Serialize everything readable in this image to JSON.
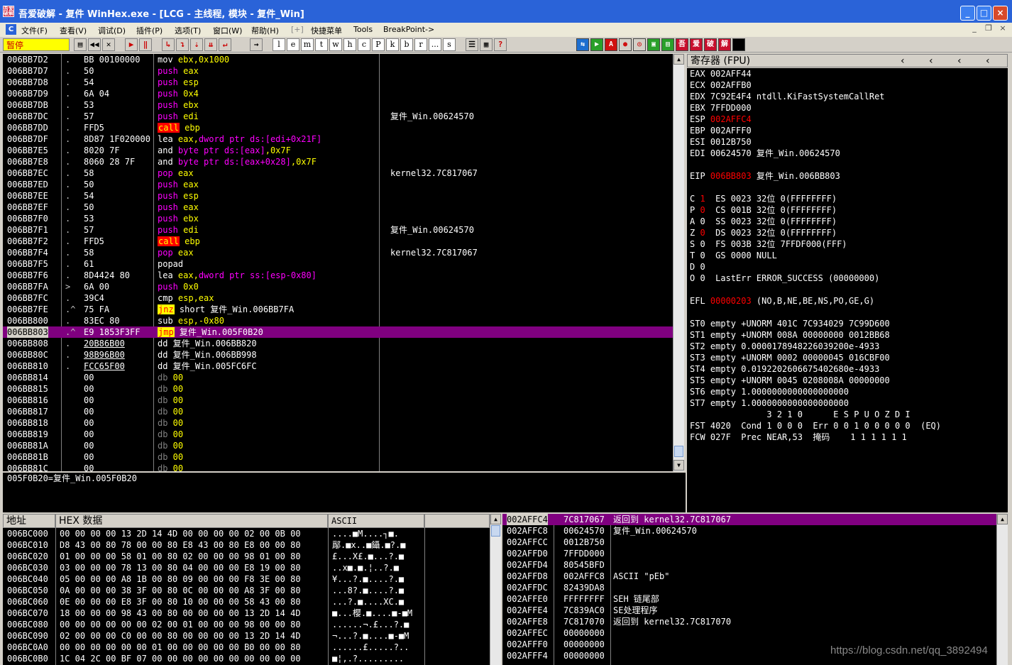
{
  "window": {
    "title": "吾爱破解 - 复件 WinHex.exe - [LCG - 主线程, 模块 - 复件_Win]",
    "logo": "吾爱破解"
  },
  "menu": [
    "文件(F)",
    "查看(V)",
    "调试(D)",
    "插件(P)",
    "选项(T)",
    "窗口(W)",
    "帮助(H)",
    "[+]",
    "快捷菜单",
    "Tools",
    "BreakPoint->"
  ],
  "toolbar": {
    "status": "暂停",
    "letters": [
      "l",
      "e",
      "m",
      "t",
      "w",
      "h",
      "c",
      "P",
      "k",
      "b",
      "r",
      "...",
      "s"
    ],
    "brand": [
      "吾",
      "爱",
      "破",
      "解"
    ]
  },
  "disasm": [
    {
      "addr": "006BB7D2",
      "mark": ".",
      "hex": "BB 00100000",
      "asm": [
        [
          "mov",
          "kw-mov"
        ],
        [
          " ebx,",
          "op-reg"
        ],
        [
          "0x1000",
          "op-num"
        ]
      ],
      "cmt": ""
    },
    {
      "addr": "006BB7D7",
      "mark": ".",
      "hex": "50",
      "asm": [
        [
          "push",
          "kw-push"
        ],
        [
          " eax",
          "op-reg"
        ]
      ],
      "cmt": ""
    },
    {
      "addr": "006BB7D8",
      "mark": ".",
      "hex": "54",
      "asm": [
        [
          "push",
          "kw-push"
        ],
        [
          " esp",
          "op-reg"
        ]
      ],
      "cmt": ""
    },
    {
      "addr": "006BB7D9",
      "mark": ".",
      "hex": "6A 04",
      "asm": [
        [
          "push",
          "kw-push"
        ],
        [
          " 0x4",
          "op-num"
        ]
      ],
      "cmt": ""
    },
    {
      "addr": "006BB7DB",
      "mark": ".",
      "hex": "53",
      "asm": [
        [
          "push",
          "kw-push"
        ],
        [
          " ebx",
          "op-reg"
        ]
      ],
      "cmt": ""
    },
    {
      "addr": "006BB7DC",
      "mark": ".",
      "hex": "57",
      "asm": [
        [
          "push",
          "kw-push"
        ],
        [
          " edi",
          "op-reg"
        ]
      ],
      "cmt": "复件_Win.00624570"
    },
    {
      "addr": "006BB7DD",
      "mark": ".",
      "hex": "FFD5",
      "asm": [
        [
          "call",
          "kw-call"
        ],
        [
          " ebp",
          "op-reg"
        ]
      ],
      "cmt": ""
    },
    {
      "addr": "006BB7DF",
      "mark": ".",
      "hex": "8D87 1F020000",
      "asm": [
        [
          "lea",
          "kw-lea"
        ],
        [
          " eax,",
          "op-reg"
        ],
        [
          "dword ptr ds:[edi+0x21F]",
          "op-mem"
        ]
      ],
      "cmt": ""
    },
    {
      "addr": "006BB7E5",
      "mark": ".",
      "hex": "8020 7F",
      "asm": [
        [
          "and",
          "kw-and"
        ],
        [
          " byte ptr ds:[eax]",
          "op-mem"
        ],
        [
          ",0x7F",
          "op-num"
        ]
      ],
      "cmt": ""
    },
    {
      "addr": "006BB7E8",
      "mark": ".",
      "hex": "8060 28 7F",
      "asm": [
        [
          "and",
          "kw-and"
        ],
        [
          " byte ptr ds:[eax+0x28]",
          "op-mem"
        ],
        [
          ",0x7F",
          "op-num"
        ]
      ],
      "cmt": ""
    },
    {
      "addr": "006BB7EC",
      "mark": ".",
      "hex": "58",
      "asm": [
        [
          "pop",
          "kw-pop"
        ],
        [
          " eax",
          "op-reg"
        ]
      ],
      "cmt": "kernel32.7C817067"
    },
    {
      "addr": "006BB7ED",
      "mark": ".",
      "hex": "50",
      "asm": [
        [
          "push",
          "kw-push"
        ],
        [
          " eax",
          "op-reg"
        ]
      ],
      "cmt": ""
    },
    {
      "addr": "006BB7EE",
      "mark": ".",
      "hex": "54",
      "asm": [
        [
          "push",
          "kw-push"
        ],
        [
          " esp",
          "op-reg"
        ]
      ],
      "cmt": ""
    },
    {
      "addr": "006BB7EF",
      "mark": ".",
      "hex": "50",
      "asm": [
        [
          "push",
          "kw-push"
        ],
        [
          " eax",
          "op-reg"
        ]
      ],
      "cmt": ""
    },
    {
      "addr": "006BB7F0",
      "mark": ".",
      "hex": "53",
      "asm": [
        [
          "push",
          "kw-push"
        ],
        [
          " ebx",
          "op-reg"
        ]
      ],
      "cmt": ""
    },
    {
      "addr": "006BB7F1",
      "mark": ".",
      "hex": "57",
      "asm": [
        [
          "push",
          "kw-push"
        ],
        [
          " edi",
          "op-reg"
        ]
      ],
      "cmt": "复件_Win.00624570"
    },
    {
      "addr": "006BB7F2",
      "mark": ".",
      "hex": "FFD5",
      "asm": [
        [
          "call",
          "kw-call"
        ],
        [
          " ebp",
          "op-reg"
        ]
      ],
      "cmt": ""
    },
    {
      "addr": "006BB7F4",
      "mark": ".",
      "hex": "58",
      "asm": [
        [
          "pop",
          "kw-pop"
        ],
        [
          " eax",
          "op-reg"
        ]
      ],
      "cmt": "kernel32.7C817067"
    },
    {
      "addr": "006BB7F5",
      "mark": ".",
      "hex": "61",
      "asm": [
        [
          "popad",
          "kw-popad"
        ]
      ],
      "cmt": ""
    },
    {
      "addr": "006BB7F6",
      "mark": ".",
      "hex": "8D4424 80",
      "asm": [
        [
          "lea",
          "kw-lea"
        ],
        [
          " eax,",
          "op-reg"
        ],
        [
          "dword ptr ss:[esp-0x80]",
          "op-mem"
        ]
      ],
      "cmt": ""
    },
    {
      "addr": "006BB7FA",
      "mark": ">",
      "hex": "6A 00",
      "asm": [
        [
          "push",
          "kw-push"
        ],
        [
          " 0x0",
          "op-num"
        ]
      ],
      "cmt": ""
    },
    {
      "addr": "006BB7FC",
      "mark": ".",
      "hex": "39C4",
      "asm": [
        [
          "cmp",
          "kw-cmp"
        ],
        [
          " esp,eax",
          "op-reg"
        ]
      ],
      "cmt": ""
    },
    {
      "addr": "006BB7FE",
      "mark": ".^",
      "hex": "75 FA",
      "asm": [
        [
          "jnz",
          "kw-jcc"
        ],
        [
          " short 复件_Win.006BB7FA",
          "op-plain"
        ]
      ],
      "cmt": ""
    },
    {
      "addr": "006BB800",
      "mark": ".",
      "hex": "83EC 80",
      "asm": [
        [
          "sub",
          "kw-sub"
        ],
        [
          " esp,",
          "op-reg"
        ],
        [
          "-0x80",
          "op-num"
        ]
      ],
      "cmt": ""
    },
    {
      "addr": "006BB803",
      "mark": ".^",
      "hex": "E9 1853F3FF",
      "asm": [
        [
          "jmp",
          "kw-jcc"
        ],
        [
          " 复件_Win.005F0B20",
          "op-plain"
        ]
      ],
      "cmt": "",
      "sel": true
    },
    {
      "addr": "006BB808",
      "mark": ".",
      "hex": "20B86B00",
      "asm": [
        [
          "dd",
          "kw-dd"
        ],
        [
          " 复件_Win.006BB820",
          "op-plain"
        ]
      ],
      "cmt": "",
      "ul": true
    },
    {
      "addr": "006BB80C",
      "mark": ".",
      "hex": "98B96B00",
      "asm": [
        [
          "dd",
          "kw-dd"
        ],
        [
          " 复件_Win.006BB998",
          "op-plain"
        ]
      ],
      "cmt": "",
      "ul": true
    },
    {
      "addr": "006BB810",
      "mark": ".",
      "hex": "FCC65F00",
      "asm": [
        [
          "dd",
          "kw-dd"
        ],
        [
          " 复件_Win.005FC6FC",
          "op-plain"
        ]
      ],
      "cmt": "",
      "ul": true
    },
    {
      "addr": "006BB814",
      "mark": "",
      "hex": "00",
      "asm": [
        [
          "db",
          "kw-db"
        ],
        [
          " 00",
          "op-reg"
        ]
      ],
      "cmt": ""
    },
    {
      "addr": "006BB815",
      "mark": "",
      "hex": "00",
      "asm": [
        [
          "db",
          "kw-db"
        ],
        [
          " 00",
          "op-reg"
        ]
      ],
      "cmt": ""
    },
    {
      "addr": "006BB816",
      "mark": "",
      "hex": "00",
      "asm": [
        [
          "db",
          "kw-db"
        ],
        [
          " 00",
          "op-reg"
        ]
      ],
      "cmt": ""
    },
    {
      "addr": "006BB817",
      "mark": "",
      "hex": "00",
      "asm": [
        [
          "db",
          "kw-db"
        ],
        [
          " 00",
          "op-reg"
        ]
      ],
      "cmt": ""
    },
    {
      "addr": "006BB818",
      "mark": "",
      "hex": "00",
      "asm": [
        [
          "db",
          "kw-db"
        ],
        [
          " 00",
          "op-reg"
        ]
      ],
      "cmt": ""
    },
    {
      "addr": "006BB819",
      "mark": "",
      "hex": "00",
      "asm": [
        [
          "db",
          "kw-db"
        ],
        [
          " 00",
          "op-reg"
        ]
      ],
      "cmt": ""
    },
    {
      "addr": "006BB81A",
      "mark": "",
      "hex": "00",
      "asm": [
        [
          "db",
          "kw-db"
        ],
        [
          " 00",
          "op-reg"
        ]
      ],
      "cmt": ""
    },
    {
      "addr": "006BB81B",
      "mark": "",
      "hex": "00",
      "asm": [
        [
          "db",
          "kw-db"
        ],
        [
          " 00",
          "op-reg"
        ]
      ],
      "cmt": ""
    },
    {
      "addr": "006BB81C",
      "mark": "",
      "hex": "00",
      "asm": [
        [
          "db",
          "kw-db"
        ],
        [
          " 00",
          "op-reg"
        ]
      ],
      "cmt": ""
    }
  ],
  "info_line": "005F0B20=复件_Win.005F0B20",
  "registers": {
    "title": "寄存器 (FPU)",
    "lines": [
      [
        [
          "EAX 002AFF44",
          ""
        ]
      ],
      [
        [
          "ECX 002AFFB0",
          ""
        ]
      ],
      [
        [
          "EDX 7C92E4F4 ntdll.KiFastSystemCallRet",
          ""
        ]
      ],
      [
        [
          "EBX 7FFDD000",
          ""
        ]
      ],
      [
        [
          "ESP ",
          ""
        ],
        [
          "002AFFC4",
          "red"
        ]
      ],
      [
        [
          "EBP 002AFFF0",
          ""
        ]
      ],
      [
        [
          "ESI 0012B750",
          ""
        ]
      ],
      [
        [
          "EDI 00624570 复件_Win.00624570",
          ""
        ]
      ],
      [
        [
          "",
          ""
        ]
      ],
      [
        [
          "EIP ",
          ""
        ],
        [
          "006BB803",
          "red"
        ],
        [
          " 复件_Win.006BB803",
          ""
        ]
      ],
      [
        [
          "",
          ""
        ]
      ],
      [
        [
          "C ",
          ""
        ],
        [
          "1",
          "red"
        ],
        [
          "  ES 0023 32位 0(FFFFFFFF)",
          ""
        ]
      ],
      [
        [
          "P ",
          ""
        ],
        [
          "0",
          "red"
        ],
        [
          "  CS 001B 32位 0(FFFFFFFF)",
          ""
        ]
      ],
      [
        [
          "A 0  SS 0023 32位 0(FFFFFFFF)",
          ""
        ]
      ],
      [
        [
          "Z ",
          ""
        ],
        [
          "0",
          "red"
        ],
        [
          "  DS 0023 32位 0(FFFFFFFF)",
          ""
        ]
      ],
      [
        [
          "S 0  FS 003B 32位 7FFDF000(FFF)",
          ""
        ]
      ],
      [
        [
          "T 0  GS 0000 NULL",
          ""
        ]
      ],
      [
        [
          "D 0",
          ""
        ]
      ],
      [
        [
          "O 0  LastErr ERROR_SUCCESS (00000000)",
          ""
        ]
      ],
      [
        [
          "",
          ""
        ]
      ],
      [
        [
          "EFL ",
          ""
        ],
        [
          "00000203",
          "red"
        ],
        [
          " (NO,B,NE,BE,NS,PO,GE,G)",
          ""
        ]
      ],
      [
        [
          "",
          ""
        ]
      ],
      [
        [
          "ST0 empty +UNORM 401C 7C934029 7C99D600",
          ""
        ]
      ],
      [
        [
          "ST1 empty +UNORM 008A 00000000 0012BB68",
          ""
        ]
      ],
      [
        [
          "ST2 empty 0.0000178948226039200e-4933",
          ""
        ]
      ],
      [
        [
          "ST3 empty +UNORM 0002 00000045 016CBF00",
          ""
        ]
      ],
      [
        [
          "ST4 empty 0.0192202606675402680e-4933",
          ""
        ]
      ],
      [
        [
          "ST5 empty +UNORM 0045 0208008A 00000000",
          ""
        ]
      ],
      [
        [
          "ST6 empty 1.0000000000000000000",
          ""
        ]
      ],
      [
        [
          "ST7 empty 1.0000000000000000000",
          ""
        ]
      ],
      [
        [
          "               3 2 1 0      E S P U O Z D I",
          ""
        ]
      ],
      [
        [
          "FST 4020  Cond 1 0 0 0  Err 0 0 1 0 0 0 0 0  (EQ)",
          ""
        ]
      ],
      [
        [
          "FCW 027F  Prec NEAR,53  掩码    1 1 1 1 1 1",
          ""
        ]
      ]
    ]
  },
  "dump": {
    "headers": {
      "addr": "地址",
      "hex": "HEX 数据",
      "ascii": "ASCII"
    },
    "rows": [
      [
        "006BC000",
        "00 00 00 00 13 2D 14 4D 00 00 00 00 02 00 0B 00",
        "....■M....┐■."
      ],
      [
        "006BC010",
        "D8 43 00 80 78 00 00 80 E8 43 00 80 E8 00 00 80",
        "鄬.■x..■鑷.■?.■"
      ],
      [
        "006BC020",
        "01 00 00 00 58 01 00 80 02 00 00 00 98 01 00 80",
        "£...X£.■...?.■"
      ],
      [
        "006BC030",
        "03 00 00 00 78 13 00 80 04 00 00 00 E8 19 00 80",
        "..x■.■.¦..?.■"
      ],
      [
        "006BC040",
        "05 00 00 00 A8 1B 00 80 09 00 00 00 F8 3E 00 80",
        "¥...?.■....?.■"
      ],
      [
        "006BC050",
        "0A 00 00 00 38 3F 00 80 0C 00 00 00 A8 3F 00 80",
        "...8?.■....?.■"
      ],
      [
        "006BC060",
        "0E 00 00 00 E8 3F 00 80 10 00 00 00 58 43 00 80",
        "...?.■....XC.■"
      ],
      [
        "006BC070",
        "18 00 00 00 98 43 00 80 00 00 00 00 13 2D 14 4D",
        "■...樱.■....■-■M"
      ],
      [
        "006BC080",
        "00 00 00 00 00 00 02 00 01 00 00 00 98 00 00 80",
        "......¬.£...?.■"
      ],
      [
        "006BC090",
        "02 00 00 00 C0 00 00 80 00 00 00 00 13 2D 14 4D",
        "¬...?.■....■-■M"
      ],
      [
        "006BC0A0",
        "00 00 00 00 00 00 01 00 00 00 00 00 B0 00 00 80",
        "......£.....?.."
      ],
      [
        "006BC0B0",
        "1C 04 2C 00 BF 07 00 00 00 00 00 00 00 00 00 00",
        "■¦,.?........."
      ]
    ]
  },
  "stack": [
    {
      "addr": "002AFFC4",
      "val": "7C817067",
      "cmt": "返回到 kernel32.7C817067",
      "sel": true
    },
    {
      "addr": "002AFFC8",
      "val": "00624570",
      "cmt": "复件_Win.00624570"
    },
    {
      "addr": "002AFFCC",
      "val": "0012B750",
      "cmt": ""
    },
    {
      "addr": "002AFFD0",
      "val": "7FFDD000",
      "cmt": ""
    },
    {
      "addr": "002AFFD4",
      "val": "80545BFD",
      "cmt": ""
    },
    {
      "addr": "002AFFD8",
      "val": "002AFFC8",
      "cmt": "ASCII \"pEb\""
    },
    {
      "addr": "002AFFDC",
      "val": "82439DA8",
      "cmt": ""
    },
    {
      "addr": "002AFFE0",
      "val": "FFFFFFFF",
      "cmt": "SEH 链尾部"
    },
    {
      "addr": "002AFFE4",
      "val": "7C839AC0",
      "cmt": "SE处理程序"
    },
    {
      "addr": "002AFFE8",
      "val": "7C817070",
      "cmt": "返回到 kernel32.7C817070"
    },
    {
      "addr": "002AFFEC",
      "val": "00000000",
      "cmt": ""
    },
    {
      "addr": "002AFFF0",
      "val": "00000000",
      "cmt": ""
    },
    {
      "addr": "002AFFF4",
      "val": "00000000",
      "cmt": ""
    }
  ],
  "watermark": "https://blog.csdn.net/qq_3892494"
}
